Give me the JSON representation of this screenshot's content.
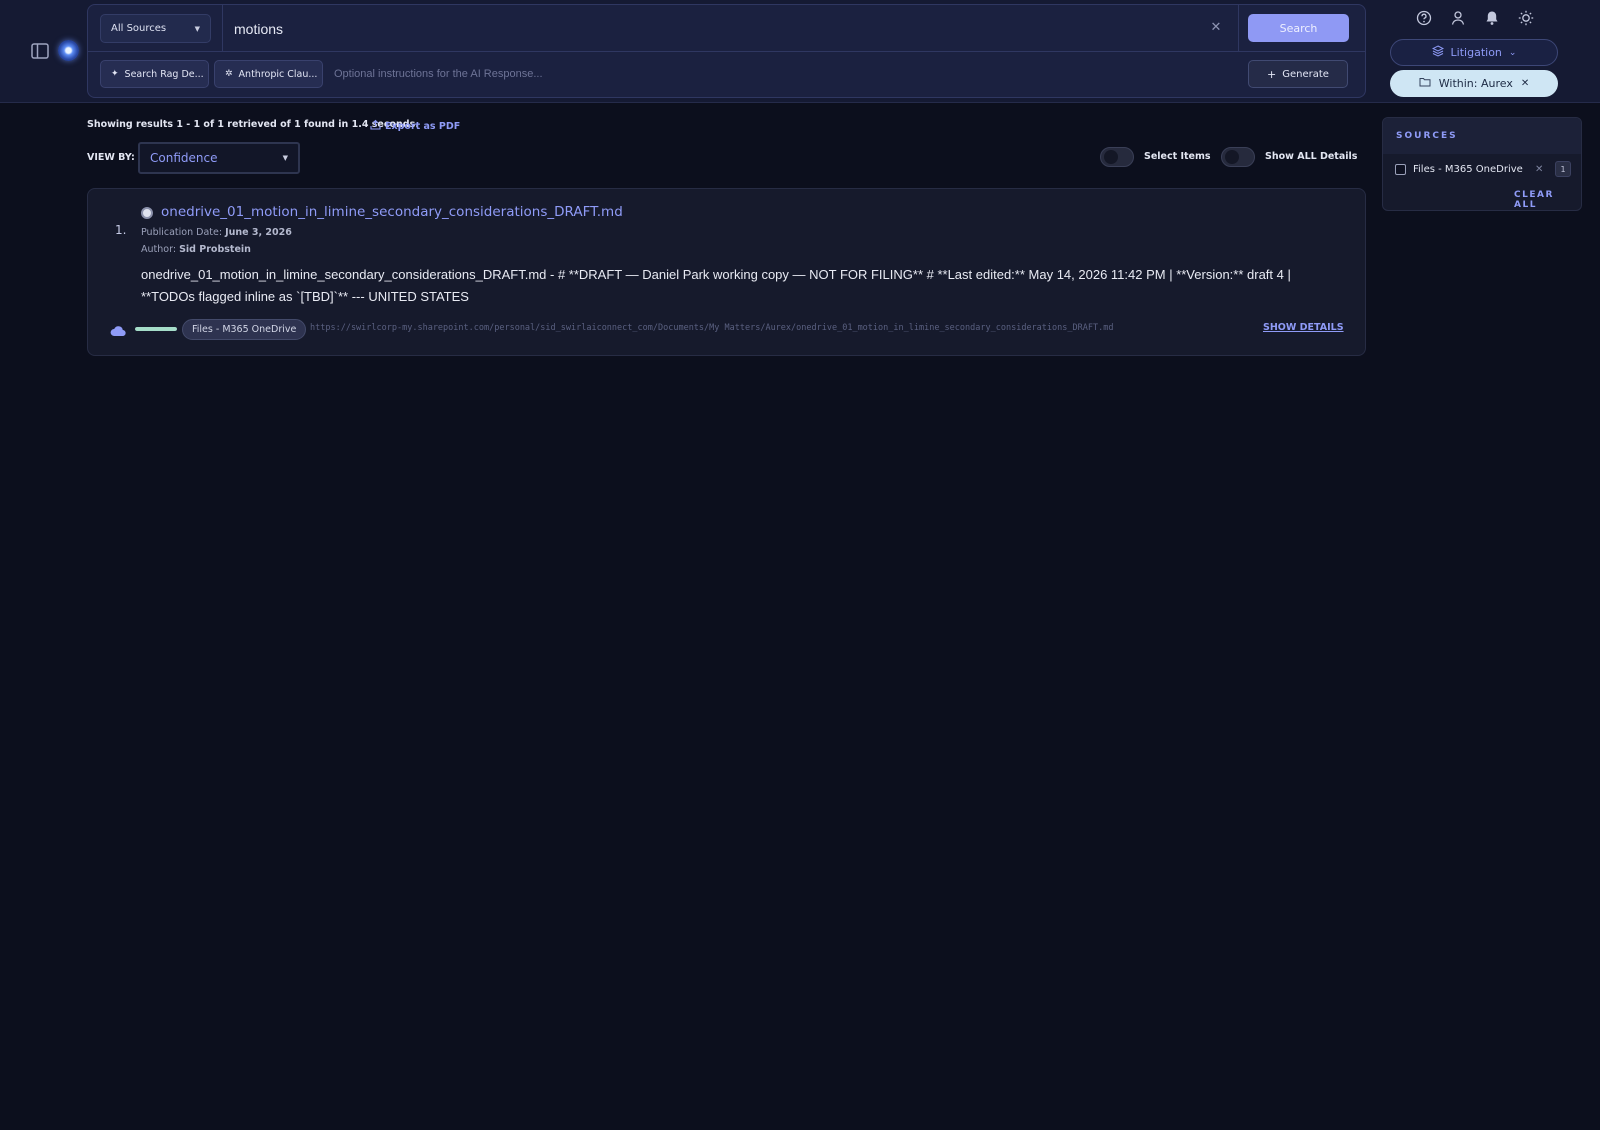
{
  "search": {
    "source_select": "All Sources",
    "query": "motions",
    "search_label": "Search",
    "rag_chip": "Search Rag De...",
    "anthropic_chip": "Anthropic Clau...",
    "ai_placeholder": "Optional instructions for the AI Response...",
    "generate_label": "Generate"
  },
  "header": {
    "litigation_label": "Litigation",
    "within_label": "Within: Aurex",
    "icons": [
      "help-icon",
      "user-icon",
      "bell-icon",
      "theme-sun-icon"
    ]
  },
  "results_bar": {
    "summary": "Showing results 1 - 1 of 1 retrieved of 1 found in 1.4 seconds.",
    "export_label": "Export as PDF",
    "viewby_label": "VIEW BY:",
    "viewby_value": "Confidence",
    "select_items_label": "Select Items",
    "show_all_details_label": "Show ALL Details"
  },
  "results": [
    {
      "number": "1.",
      "title": "onedrive_01_motion_in_limine_secondary_considerations_DRAFT.md",
      "publication_label": "Publication Date:",
      "publication_date": "June 3, 2026",
      "author_label": "Author:",
      "author": "Sid Probstein",
      "snippet": "onedrive_01_motion_in_limine_secondary_considerations_DRAFT.md - # **DRAFT — Daniel Park working copy — NOT FOR FILING** # **Last edited:** May 14, 2026 11:42 PM | **Version:** draft 4 | **TODOs flagged inline as `[TBD]`** --- UNITED STATES",
      "source": "Files - M365 OneDrive",
      "url": "https://swirlcorp-my.sharepoint.com/personal/sid_swirlaiconnect_com/Documents/My Matters/Aurex/onedrive_01_motion_in_limine_secondary_considerations_DRAFT.md",
      "confidence_fraction": 1.0,
      "show_details_label": "SHOW DETAILS"
    }
  ],
  "sources_panel": {
    "heading": "SOURCES",
    "items": [
      {
        "label": "Files - M365 OneDrive",
        "count": "1"
      }
    ],
    "clear_all_label": "CLEAR ALL"
  },
  "colors": {
    "accent": "#8f9bf7",
    "background": "#0c0f1d",
    "header": "#151a33",
    "confidence": "#a5ddc9"
  }
}
